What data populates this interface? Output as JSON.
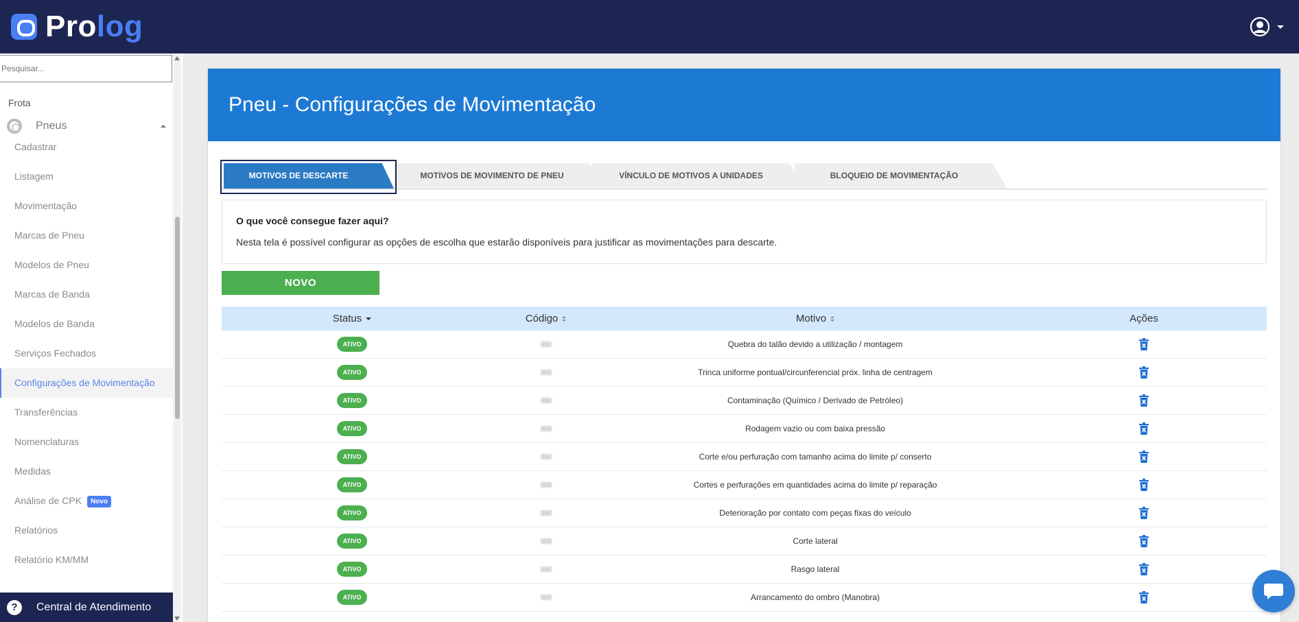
{
  "app": {
    "logo_part1": "Pro",
    "logo_part2": "log",
    "brand_color": "#1d2552",
    "accent_color": "#4a7ff2"
  },
  "header": {
    "user_icon": "user-circle-icon",
    "menu_icon": "caret-down-icon"
  },
  "sidebar": {
    "search_placeholder": "Pesquisar...",
    "section": "Frota",
    "group": {
      "label": "Pneus",
      "icon": "tire-icon"
    },
    "items": [
      {
        "label": "Cadastrar"
      },
      {
        "label": "Listagem"
      },
      {
        "label": "Movimentação"
      },
      {
        "label": "Marcas de Pneu"
      },
      {
        "label": "Modelos de Pneu"
      },
      {
        "label": "Marcas de Banda"
      },
      {
        "label": "Modelos de Banda"
      },
      {
        "label": "Serviços Fechados"
      },
      {
        "label": "Configurações de Movimentação",
        "active": true
      },
      {
        "label": "Transferências"
      },
      {
        "label": "Nomenclaturas"
      },
      {
        "label": "Medidas"
      },
      {
        "label": "Análise de CPK",
        "badge": "Novo"
      },
      {
        "label": "Relatórios"
      },
      {
        "label": "Relatório KM/MM"
      }
    ],
    "help_label": "Central de Atendimento"
  },
  "page": {
    "title": "Pneu - Configurações de Movimentação",
    "header_color": "#1d7ad4"
  },
  "tabs": [
    {
      "label": "MOTIVOS DE DESCARTE",
      "active": true
    },
    {
      "label": "MOTIVOS DE MOVIMENTO DE PNEU"
    },
    {
      "label": "VÍNCULO DE MOTIVOS A UNIDADES"
    },
    {
      "label": "BLOQUEIO DE MOVIMENTAÇÃO"
    }
  ],
  "info": {
    "title": "O que você consegue fazer aqui?",
    "text": "Nesta tela é possível configurar as opções de escolha que estarão disponíveis para justificar as movimentações para descarte."
  },
  "new_button": "NOVO",
  "table": {
    "columns": [
      "Status",
      "Código",
      "Motivo",
      "Ações"
    ],
    "rows": [
      {
        "status": "ATIVO",
        "motivo": "Quebra do talão devido a utilização / montagem"
      },
      {
        "status": "ATIVO",
        "motivo": "Trinca uniforme pontual/circunferencial próx. linha de centragem"
      },
      {
        "status": "ATIVO",
        "motivo": "Contaminação (Químico / Derivado de Petróleo)"
      },
      {
        "status": "ATIVO",
        "motivo": "Rodagem vazio ou com baixa pressão"
      },
      {
        "status": "ATIVO",
        "motivo": "Corte e/ou perfuração com tamanho acima do limite p/ conserto"
      },
      {
        "status": "ATIVO",
        "motivo": "Cortes e perfurações em quantidades acima do limite p/ reparação"
      },
      {
        "status": "ATIVO",
        "motivo": "Deterioração por contato com peças fixas do veículo"
      },
      {
        "status": "ATIVO",
        "motivo": "Corte lateral"
      },
      {
        "status": "ATIVO",
        "motivo": "Rasgo lateral"
      },
      {
        "status": "ATIVO",
        "motivo": "Arrancamento do ombro (Manobra)"
      }
    ],
    "status_color": "#4caf50",
    "action_icon": "trash-icon"
  },
  "chat": {
    "icon": "chat-bubble-icon"
  }
}
